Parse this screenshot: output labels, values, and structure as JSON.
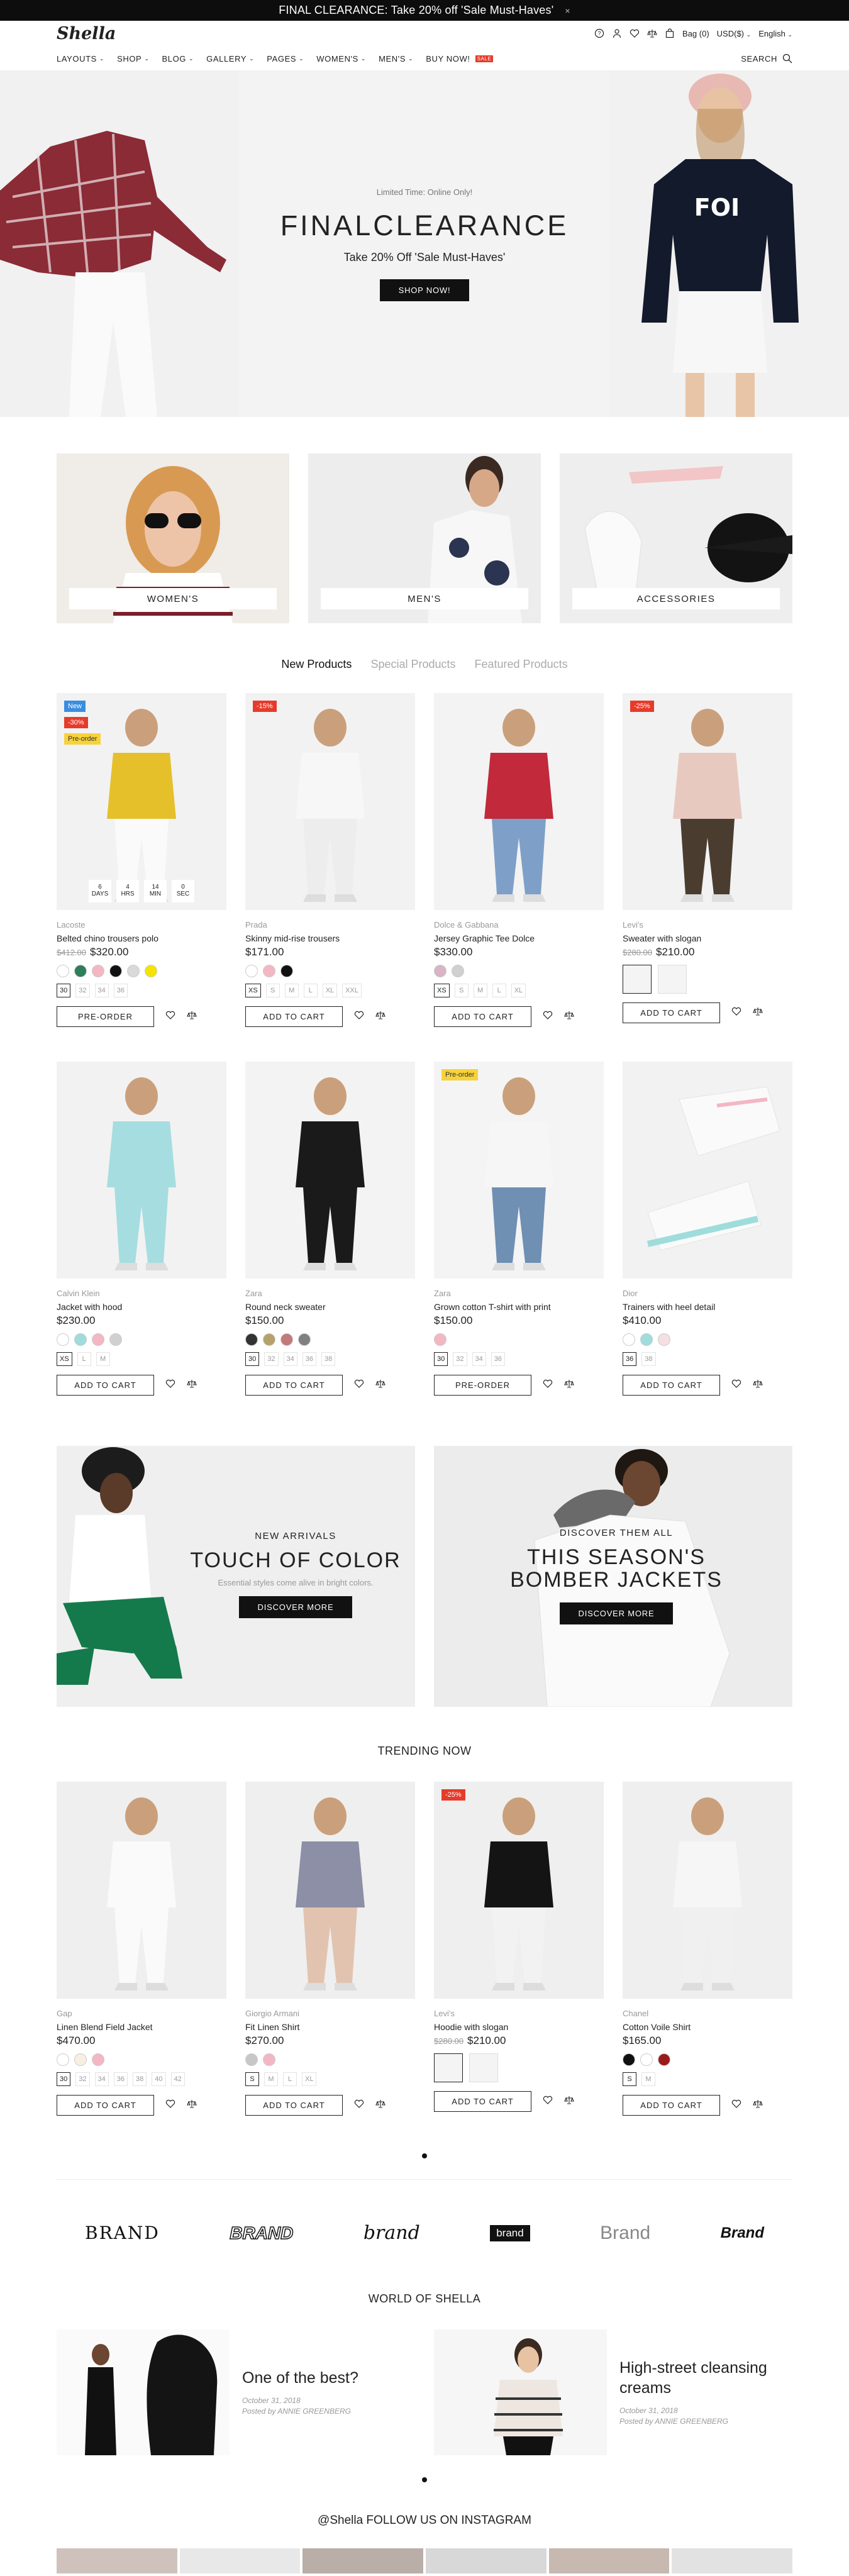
{
  "announcement": {
    "text": "FINAL CLEARANCE: Take 20% off 'Sale Must-Haves'",
    "close": "×"
  },
  "header": {
    "logo": "Shella",
    "bag_label": "Bag (0)",
    "currency": "USD($)",
    "language": "English",
    "nav": [
      {
        "label": "LAYOUTS",
        "dropdown": true
      },
      {
        "label": "SHOP",
        "dropdown": true
      },
      {
        "label": "BLOG",
        "dropdown": true
      },
      {
        "label": "GALLERY",
        "dropdown": true
      },
      {
        "label": "PAGES",
        "dropdown": true
      },
      {
        "label": "WOMEN'S",
        "dropdown": true
      },
      {
        "label": "MEN'S",
        "dropdown": true
      },
      {
        "label": "BUY NOW!",
        "dropdown": false,
        "badge": "SALE"
      }
    ],
    "search_label": "SEARCH"
  },
  "hero": {
    "kicker": "Limited Time: Online Only!",
    "title": "FINALCLEARANCE",
    "subtitle": "Take 20% Off 'Sale Must-Haves'",
    "button": "SHOP NOW!"
  },
  "categories": [
    "WOMEN'S",
    "MEN'S",
    "ACCESSORIES"
  ],
  "tabs": [
    "New Products",
    "Special Products",
    "Featured Products"
  ],
  "products_row1": [
    {
      "brand": "Lacoste",
      "name": "Belted chino trousers polo",
      "old": "$412.00",
      "price": "$320.00",
      "badges": [
        "New",
        "-30%",
        "Pre-order"
      ],
      "timer": [
        [
          "6",
          "DAYS"
        ],
        [
          "4",
          "HRS"
        ],
        [
          "14",
          "MIN"
        ],
        [
          "0",
          "SEC"
        ]
      ],
      "swatches": [
        "#ffffff",
        "#2e7d5b",
        "#f3b7c3",
        "#111111",
        "#d9d9d9",
        "#f5e400"
      ],
      "sizes": [
        "30",
        "32",
        "34",
        "36"
      ],
      "button": "PRE-ORDER"
    },
    {
      "brand": "Prada",
      "name": "Skinny mid-rise trousers",
      "old": "",
      "price": "$171.00",
      "badges": [
        "-15%"
      ],
      "swatches": [
        "#ffffff",
        "#f3b7c3",
        "#111111"
      ],
      "sizes": [
        "XS",
        "S",
        "M",
        "L",
        "XL",
        "XXL"
      ],
      "button": "ADD TO CART"
    },
    {
      "brand": "Dolce & Gabbana",
      "name": "Jersey Graphic Tee Dolce",
      "old": "",
      "price": "$330.00",
      "badges": [],
      "swatches": [
        "#d9b3c6",
        "#d0d0d0"
      ],
      "sizes": [
        "XS",
        "S",
        "M",
        "L",
        "XL"
      ],
      "button": "ADD TO CART"
    },
    {
      "brand": "Levi's",
      "name": "Sweater with slogan",
      "old": "$280.00",
      "price": "$210.00",
      "badges": [
        "-25%"
      ],
      "thumbs": 2,
      "button": "ADD TO CART"
    }
  ],
  "products_row2": [
    {
      "brand": "Calvin Klein",
      "name": "Jacket with hood",
      "price": "$230.00",
      "badges": [],
      "swatches": [
        "#ffffff",
        "#9fdcdc",
        "#f3b7c3",
        "#d0d0d0"
      ],
      "sizes": [
        "XS",
        "L",
        "M"
      ],
      "button": "ADD TO CART"
    },
    {
      "brand": "Zara",
      "name": "Round neck sweater",
      "price": "$150.00",
      "badges": [],
      "swatches": [
        "#333333",
        "#b7a16a",
        "#c07a7a",
        "#808080"
      ],
      "sizes": [
        "30",
        "32",
        "34",
        "36",
        "38"
      ],
      "button": "ADD TO CART"
    },
    {
      "brand": "Zara",
      "name": "Grown cotton T-shirt with print",
      "price": "$150.00",
      "badges": [
        "Pre-order"
      ],
      "swatches": [
        "#f3b7c3"
      ],
      "sizes": [
        "30",
        "32",
        "34",
        "36"
      ],
      "button": "PRE-ORDER"
    },
    {
      "brand": "Dior",
      "name": "Trainers with heel detail",
      "price": "$410.00",
      "badges": [],
      "swatches": [
        "#ffffff",
        "#9fdcdc",
        "#f6dfe3"
      ],
      "sizes": [
        "36",
        "38"
      ],
      "button": "ADD TO CART"
    }
  ],
  "promos": [
    {
      "kicker": "NEW ARRIVALS",
      "title": "TOUCH OF COLOR",
      "desc": "Essential styles come alive in bright colors.",
      "button": "DISCOVER MORE"
    },
    {
      "kicker": "DISCOVER THEM ALL",
      "title": "THIS SEASON'S BOMBER JACKETS",
      "desc": "",
      "button": "DISCOVER MORE"
    }
  ],
  "trending_title": "TRENDING NOW",
  "trending": [
    {
      "brand": "Gap",
      "name": "Linen Blend Field Jacket",
      "price": "$470.00",
      "badges": [],
      "swatches": [
        "#ffffff",
        "#f7f0e0",
        "#f3b7c3"
      ],
      "sizes": [
        "30",
        "32",
        "34",
        "36",
        "38",
        "40",
        "42"
      ],
      "button": "ADD TO CART"
    },
    {
      "brand": "Giorgio Armani",
      "name": "Fit Linen Shirt",
      "price": "$270.00",
      "badges": [],
      "swatches": [
        "#c7c7c7",
        "#f3b7c3"
      ],
      "sizes": [
        "S",
        "M",
        "L",
        "XL"
      ],
      "button": "ADD TO CART"
    },
    {
      "brand": "Levi's",
      "name": "Hoodie with slogan",
      "old": "$280.00",
      "price": "$210.00",
      "badges": [
        "-25%"
      ],
      "thumbs": 2,
      "button": "ADD TO CART"
    },
    {
      "brand": "Chanel",
      "name": "Cotton Voile Shirt",
      "price": "$165.00",
      "badges": [],
      "swatches": [
        "#111111",
        "#ffffff",
        "#9b1b1b"
      ],
      "sizes": [
        "S",
        "M"
      ],
      "button": "ADD TO CART"
    }
  ],
  "brands": [
    "BRAND",
    "BRAND",
    "brand",
    "brand",
    "Brand",
    "Brand"
  ],
  "world_title": "WORLD OF SHELLA",
  "posts": [
    {
      "title": "One of the best?",
      "date": "October 31, 2018",
      "author": "Posted by ANNIE GREENBERG"
    },
    {
      "title": "High-street cleansing creams",
      "date": "October 31, 2018",
      "author": "Posted by ANNIE GREENBERG"
    }
  ],
  "instagram_title": "@Shella FOLLOW US ON INSTAGRAM",
  "colors": {
    "sale": "#e63b2a",
    "new": "#3a8de0",
    "preorder": "#f7d23a",
    "dark": "#111111"
  }
}
